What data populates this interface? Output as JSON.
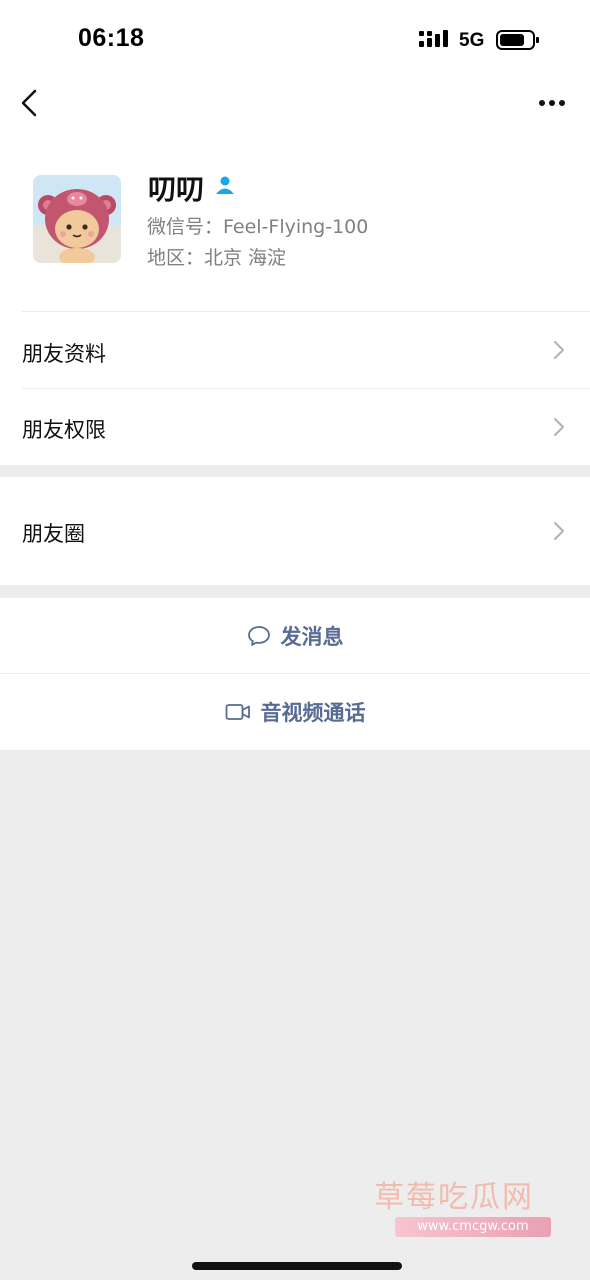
{
  "status_bar": {
    "time": "06:18",
    "network": "5G"
  },
  "nav": {
    "back_icon": "chevron-left-icon",
    "more_icon": "ellipsis-icon"
  },
  "profile": {
    "nickname": "叨叨",
    "wechat_id": "微信号：Feel-Flying-100",
    "region": "地区：北京 海淀",
    "verified_icon": "contact-person-icon",
    "verified_color": "#1aa7e8"
  },
  "menu": {
    "profile_info": "朋友资料",
    "permissions": "朋友权限",
    "moments": "朋友圈"
  },
  "actions": {
    "message": "发消息",
    "call": "音视频通话",
    "accent_color": "#576b95"
  },
  "watermark": {
    "text": "草莓吃瓜网",
    "url": "www.cmcgw.com"
  }
}
